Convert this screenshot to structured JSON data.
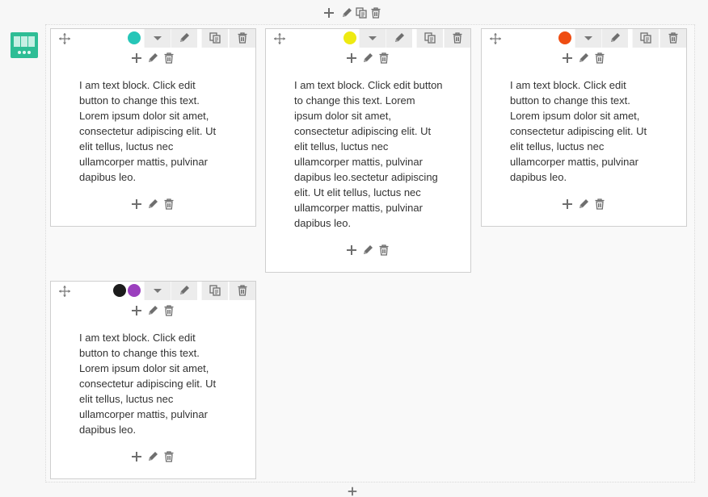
{
  "colors": {
    "teal": "#26c6b8",
    "yellow": "#eeea12",
    "orange": "#ef4d12",
    "purple": "#9b3fbe",
    "black": "#1c1c1c",
    "row_icon": "#2ebd95"
  },
  "icons": {
    "add": "plus-icon",
    "edit": "pencil-icon",
    "clone": "copy-icon",
    "delete": "trash-icon",
    "move": "move-arrows-icon",
    "dropdown": "chevron-down-icon",
    "layout": "columns-layout-icon"
  },
  "blocks": [
    {
      "text": "I am text block. Click edit button to change this text. Lorem ipsum dolor sit amet, consectetur adipiscing elit. Ut elit tellus, luctus nec ullamcorper mattis, pulvinar dapibus leo.",
      "color_dots": [
        "teal"
      ]
    },
    {
      "text": "I am text block. Click edit button to change this text. Lorem ipsum dolor sit amet, consectetur adipiscing elit. Ut elit tellus, luctus nec ullamcorper mattis, pulvinar dapibus leo.sectetur adipiscing elit. Ut elit tellus, luctus nec ullamcorper mattis, pulvinar dapibus leo.",
      "color_dots": [
        "yellow"
      ]
    },
    {
      "text": "I am text block. Click edit button to change this text. Lorem ipsum dolor sit amet, consectetur adipiscing elit. Ut elit tellus, luctus nec ullamcorper mattis, pulvinar dapibus leo.",
      "color_dots": [
        "orange"
      ]
    },
    {
      "text": "I am text block. Click edit button to change this text. Lorem ipsum dolor sit amet, consectetur adipiscing elit. Ut elit tellus, luctus nec ullamcorper mattis, pulvinar dapibus leo.",
      "color_dots": [
        "black",
        "purple"
      ]
    }
  ]
}
